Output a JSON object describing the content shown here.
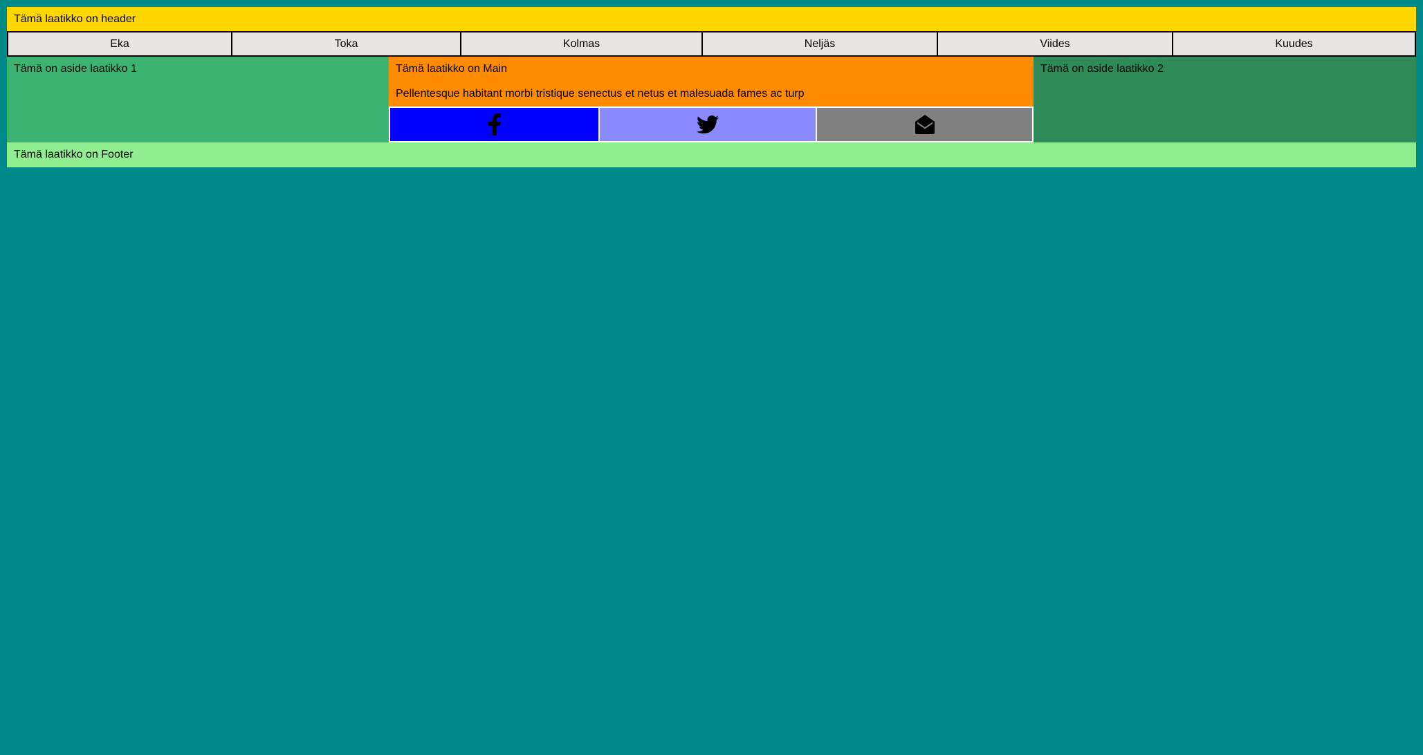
{
  "header": {
    "text": "Tämä laatikko on header"
  },
  "nav": {
    "items": [
      {
        "label": "Eka"
      },
      {
        "label": "Toka"
      },
      {
        "label": "Kolmas"
      },
      {
        "label": "Neljäs"
      },
      {
        "label": "Viides"
      },
      {
        "label": "Kuudes"
      }
    ]
  },
  "aside1": {
    "text": "Tämä on aside laatikko 1"
  },
  "main": {
    "title": "Tämä laatikko on Main",
    "paragraph": "Pellentesque habitant morbi tristique senectus et netus et malesuada fames ac turp"
  },
  "aside2": {
    "text": "Tämä on aside laatikko 2"
  },
  "footer": {
    "text": "Tämä laatikko on Footer"
  },
  "social": {
    "buttons": [
      {
        "icon": "facebook-icon",
        "color": "#0000ff"
      },
      {
        "icon": "twitter-icon",
        "color": "#8b8bff"
      },
      {
        "icon": "envelope-open-icon",
        "color": "#808080"
      }
    ]
  },
  "colors": {
    "page_background": "#008b8b",
    "header": "#ffd700",
    "nav_button": "#e8e5e3",
    "aside1": "#3cb371",
    "main": "#ff8c00",
    "aside2": "#2e8b57",
    "footer": "#90ee90"
  }
}
